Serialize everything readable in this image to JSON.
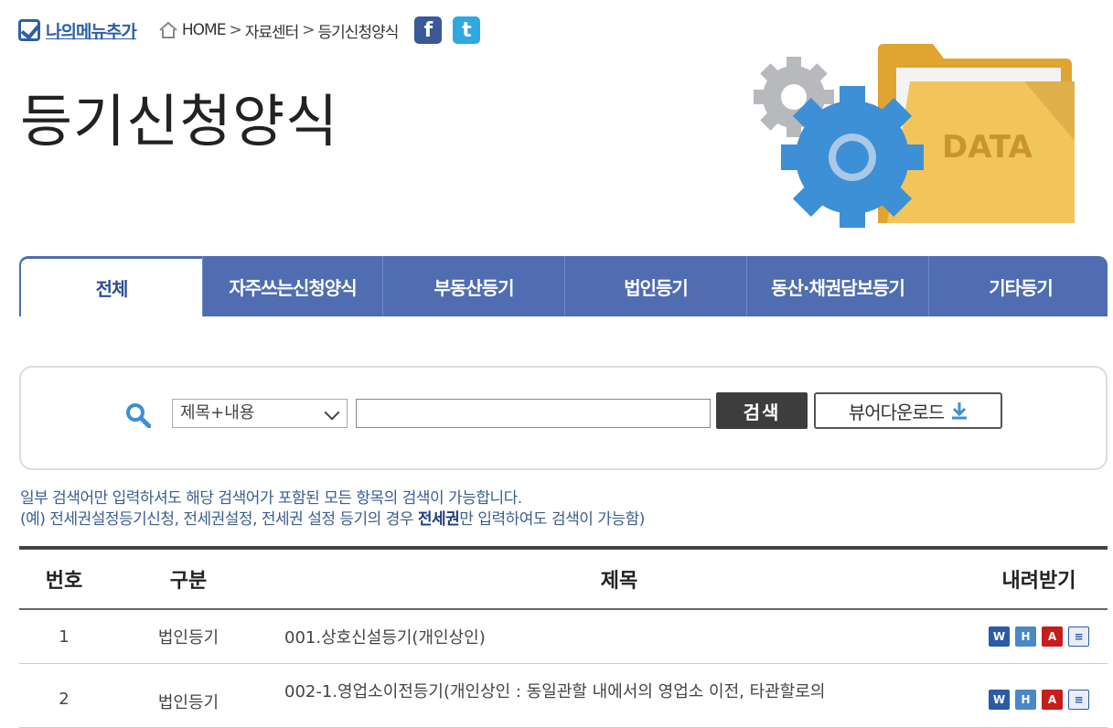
{
  "topbar": {
    "my_menu_label": "나의메뉴추가",
    "breadcrumb": [
      "HOME",
      "자료센터",
      "등기신청양식"
    ],
    "facebook_glyph": "f",
    "twitter_glyph": "t"
  },
  "page": {
    "title": "등기신청양식"
  },
  "hero": {
    "folder_label": "DATA"
  },
  "tabs": [
    {
      "label": "전체"
    },
    {
      "label": "자주쓰는신청양식"
    },
    {
      "label": "부동산등기"
    },
    {
      "label": "법인등기"
    },
    {
      "label": "동산·채권담보등기"
    },
    {
      "label": "기타등기"
    }
  ],
  "search": {
    "select_value": "제목+내용",
    "input_value": "",
    "search_button": "검색",
    "viewer_button": "뷰어다운로드"
  },
  "help": {
    "line1": "일부 검색어만 입력하셔도 해당 검색어가 포함된 모든 항목의 검색이 가능합니다.",
    "line2_pre": "(예) 전세권설정등기신청, 전세권설정, 전세권 설정 등기의 경우 ",
    "line2_bold": "전세권",
    "line2_post": "만 입력하여도 검색이 가능함)"
  },
  "table": {
    "headers": {
      "no": "번호",
      "category": "구분",
      "title": "제목",
      "download": "내려받기"
    },
    "rows": [
      {
        "no": "1",
        "category": "법인등기",
        "title": "001.상호신설등기(개인상인)"
      },
      {
        "no": "2",
        "category": "법인등기",
        "title": "002-1.영업소이전등기(개인상인 : 동일관할 내에서의 영업소 이전, 타관할로의"
      }
    ],
    "file_icons": {
      "word": "W",
      "hwp": "H",
      "pdf": "A",
      "txt": "≡"
    }
  },
  "colors": {
    "tab_bg": "#4f6db0",
    "accent": "#2d5fa8",
    "help_text": "#3b5f8f"
  }
}
